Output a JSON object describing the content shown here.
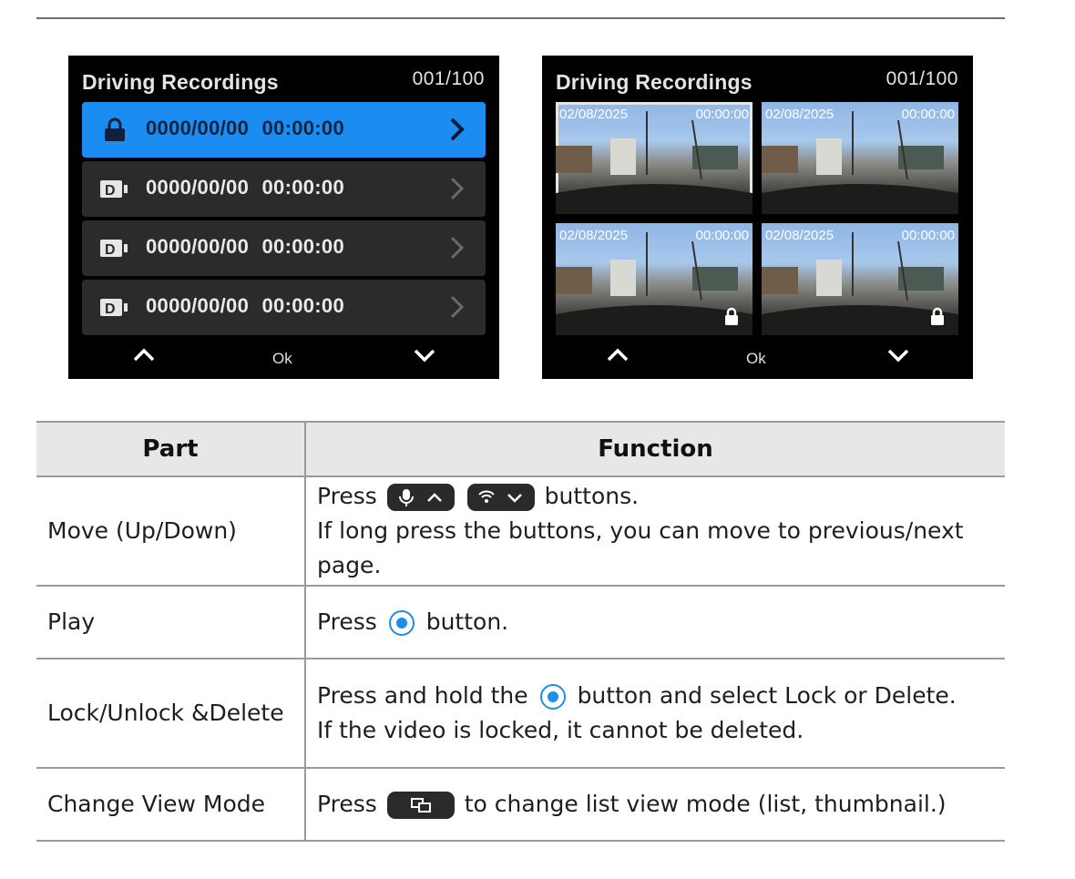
{
  "screens": {
    "list": {
      "title": "Driving Recordings",
      "counter": "001/100",
      "rows": [
        {
          "text": "0000/00/00  00:00:00",
          "icon": "lock-icon",
          "selected": true
        },
        {
          "text": "0000/00/00  00:00:00",
          "icon": "video-icon",
          "selected": false
        },
        {
          "text": "0000/00/00  00:00:00",
          "icon": "video-icon",
          "selected": false
        },
        {
          "text": "0000/00/00  00:00:00",
          "icon": "video-icon",
          "selected": false
        }
      ],
      "nav_ok": "Ok"
    },
    "thumbnail": {
      "title": "Driving Recordings",
      "counter": "001/100",
      "thumbs": [
        {
          "date": "02/08/2025",
          "time": "00:00:00",
          "locked": false,
          "selected": true
        },
        {
          "date": "02/08/2025",
          "time": "00:00:00",
          "locked": false,
          "selected": false
        },
        {
          "date": "02/08/2025",
          "time": "00:00:00",
          "locked": true,
          "selected": false
        },
        {
          "date": "02/08/2025",
          "time": "00:00:00",
          "locked": true,
          "selected": false
        }
      ],
      "nav_ok": "Ok"
    }
  },
  "table": {
    "headers": {
      "part": "Part",
      "function": "Function"
    },
    "rows": {
      "move": {
        "part": "Move (Up/Down)",
        "press": "Press",
        "after_buttons": "buttons.",
        "line2": "If long press the buttons, you can move to previous/next page."
      },
      "play": {
        "part": "Play",
        "press": "Press",
        "after_button": "button."
      },
      "lock": {
        "part": "Lock/Unlock &Delete",
        "before": "Press and hold the",
        "after": "button and select Lock or Delete.",
        "line2": "If the video is locked, it cannot be deleted."
      },
      "view": {
        "part": "Change View Mode",
        "press": "Press",
        "after": "to change list view mode (list, thumbnail.)"
      }
    }
  },
  "colors": {
    "selected_row": "#1a8cf2",
    "row_bg": "#2b2b2b",
    "header_bg": "#e6e7e8",
    "ok_button_accent": "#1f8ee8"
  }
}
